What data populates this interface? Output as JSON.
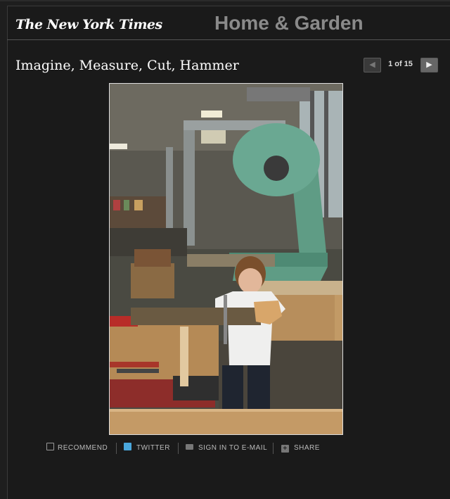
{
  "header": {
    "logo": "The New York Times",
    "section": "Home & Garden"
  },
  "slideshow": {
    "title": "Imagine, Measure, Cut, Hammer",
    "counter": "1 of 15",
    "prev_icon": "prev-arrow-icon",
    "next_icon": "next-arrow-icon"
  },
  "tools": {
    "recommend": "RECOMMEND",
    "twitter": "TWITTER",
    "email": "SIGN IN TO E-MAIL",
    "share": "SHARE"
  },
  "colors": {
    "background": "#1a1a1a",
    "section_title": "#8a8a8a",
    "twitter_blue": "#4aa7dc"
  }
}
